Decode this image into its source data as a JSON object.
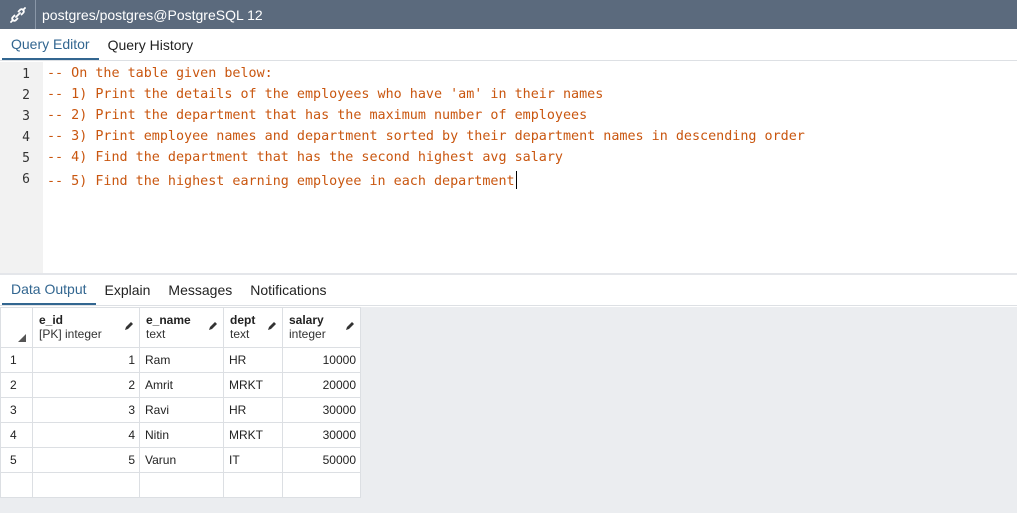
{
  "titlebar": {
    "title": "postgres/postgres@PostgreSQL 12"
  },
  "editor_tabs": [
    {
      "label": "Query Editor",
      "active": true
    },
    {
      "label": "Query History",
      "active": false
    }
  ],
  "editor": {
    "line_numbers": [
      "1",
      "2",
      "3",
      "4",
      "5",
      "6"
    ],
    "lines": [
      "-- On the table given below:",
      "-- 1) Print the details of the employees who have 'am' in their names",
      "-- 2) Print the department that has the maximum number of employees",
      "-- 3) Print employee names and department sorted by their department names in descending order",
      "-- 4) Find the department that has the second highest avg salary",
      "-- 5) Find the highest earning employee in each department"
    ]
  },
  "output_tabs": [
    {
      "label": "Data Output",
      "active": true
    },
    {
      "label": "Explain",
      "active": false
    },
    {
      "label": "Messages",
      "active": false
    },
    {
      "label": "Notifications",
      "active": false
    }
  ],
  "grid": {
    "columns": [
      {
        "name": "e_id",
        "type": "[PK] integer"
      },
      {
        "name": "e_name",
        "type": "text"
      },
      {
        "name": "dept",
        "type": "text"
      },
      {
        "name": "salary",
        "type": "integer"
      }
    ],
    "rows": [
      {
        "n": "1",
        "e_id": "1",
        "e_name": "Ram",
        "dept": "HR",
        "salary": "10000"
      },
      {
        "n": "2",
        "e_id": "2",
        "e_name": "Amrit",
        "dept": "MRKT",
        "salary": "20000"
      },
      {
        "n": "3",
        "e_id": "3",
        "e_name": "Ravi",
        "dept": "HR",
        "salary": "30000"
      },
      {
        "n": "4",
        "e_id": "4",
        "e_name": "Nitin",
        "dept": "MRKT",
        "salary": "30000"
      },
      {
        "n": "5",
        "e_id": "5",
        "e_name": "Varun",
        "dept": "IT",
        "salary": "50000"
      }
    ]
  },
  "colors": {
    "titlebar": "#5b6a7d",
    "accent": "#326690",
    "comment": "#c9560f"
  }
}
